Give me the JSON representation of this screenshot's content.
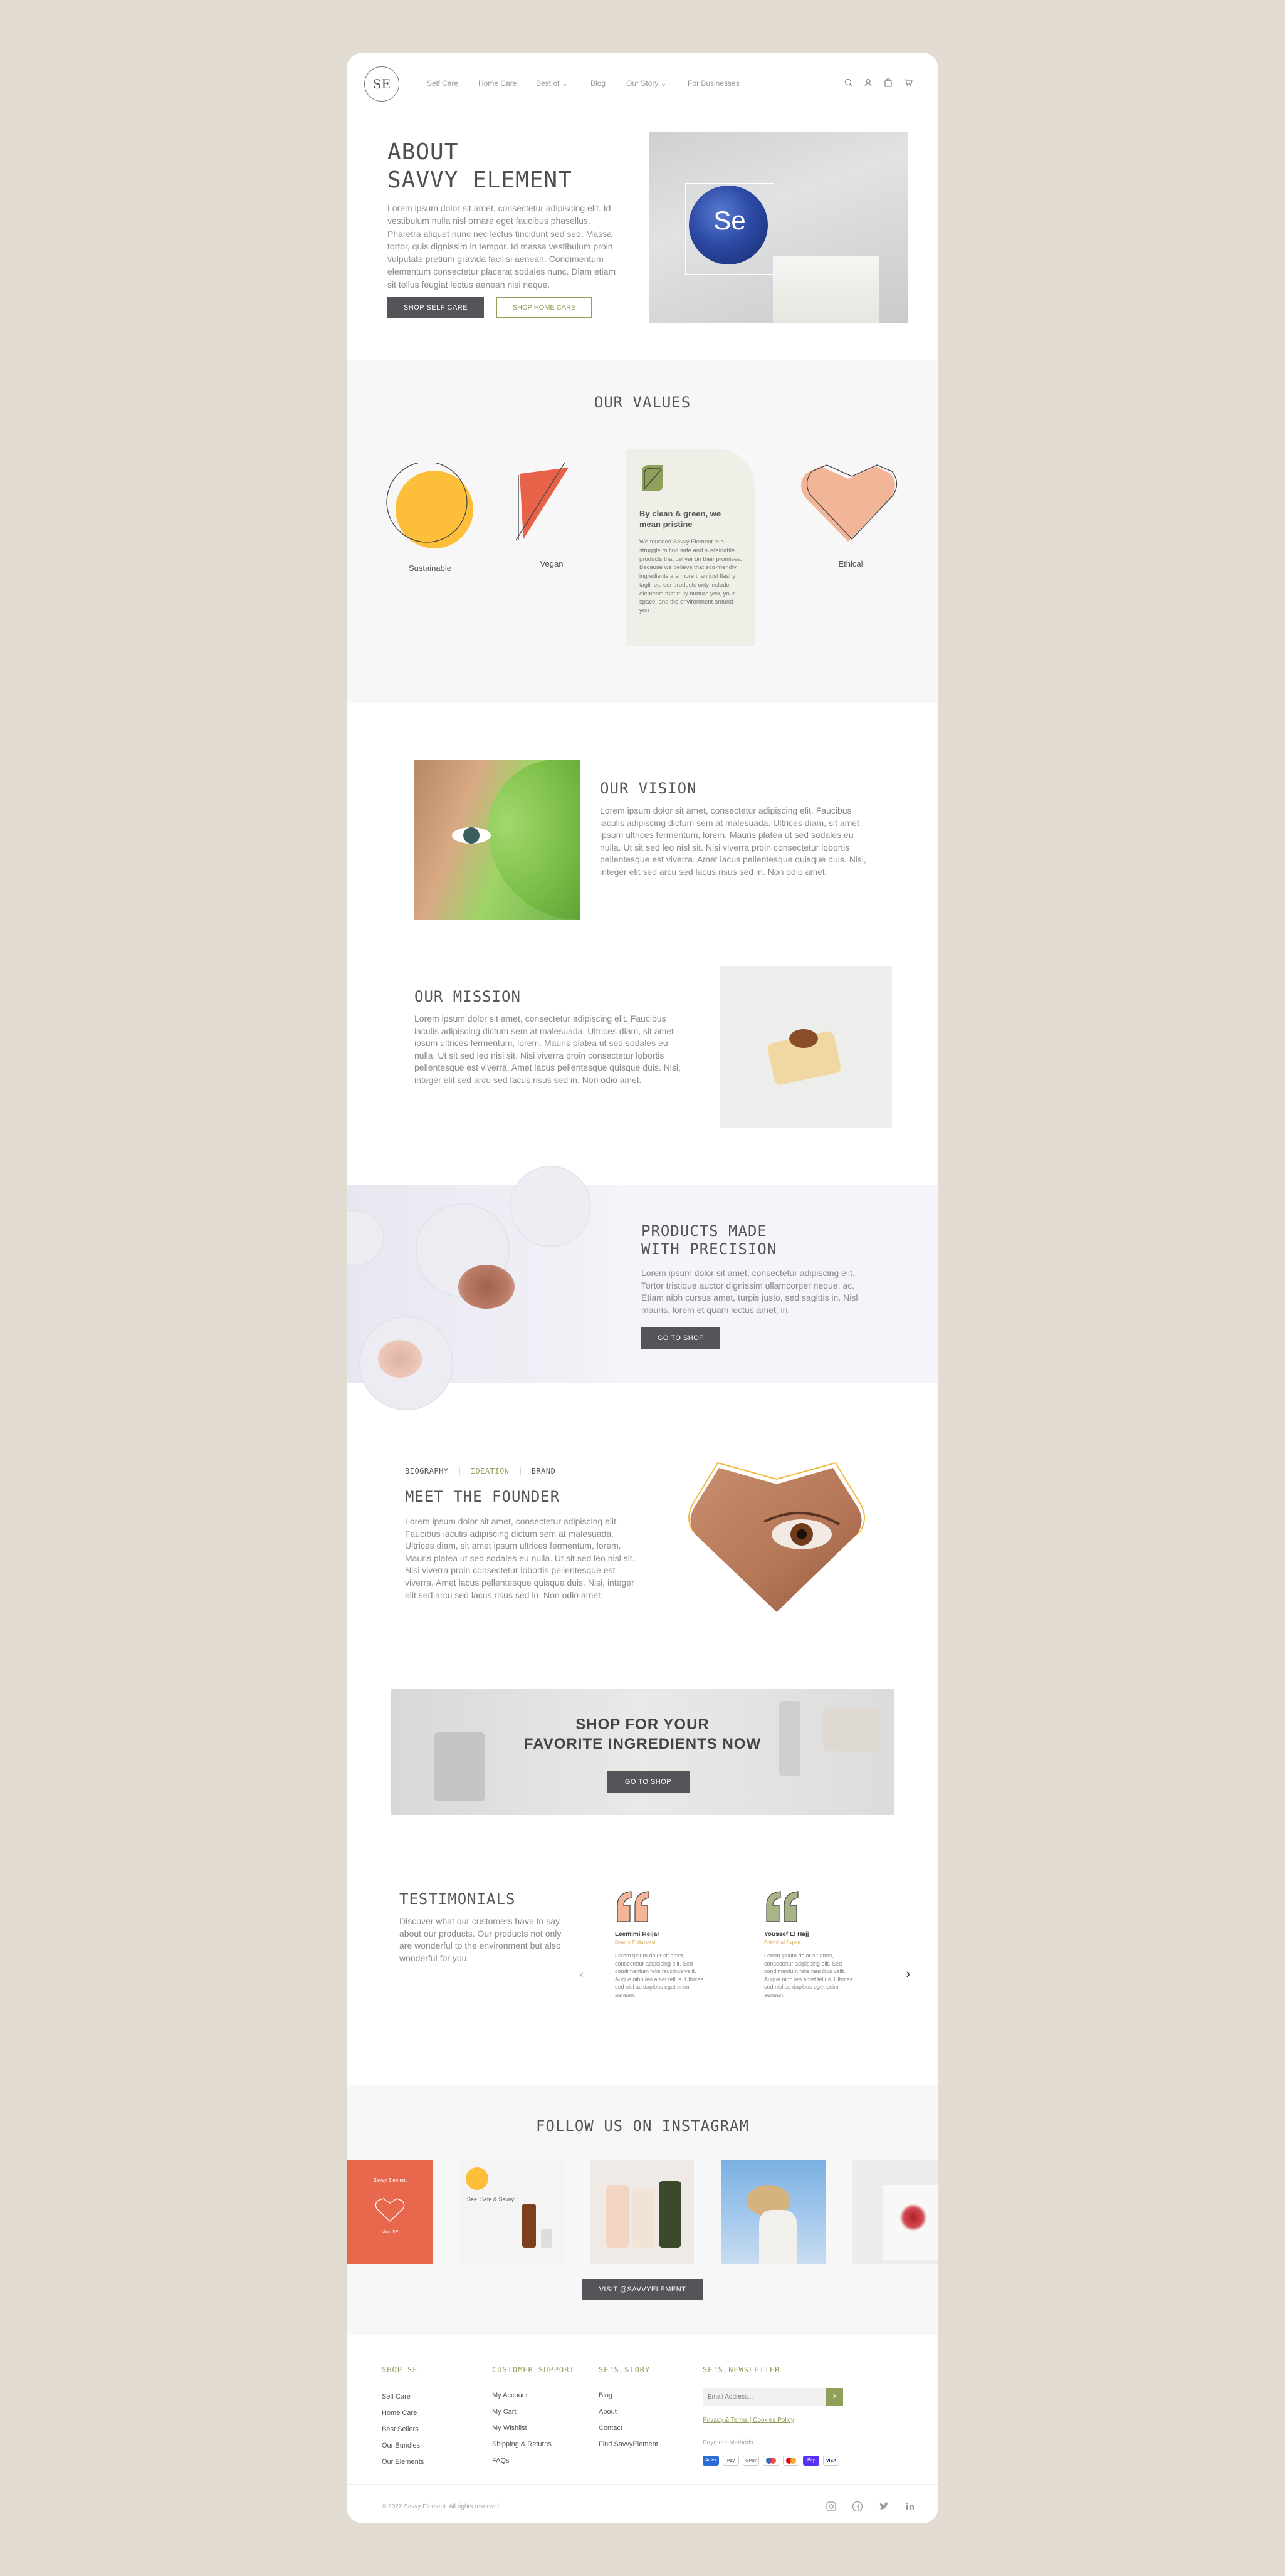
{
  "nav": {
    "logo": "SE",
    "items": [
      "Self Care",
      "Home Care",
      "Best of",
      "Blog",
      "Our Story",
      "For Businesses"
    ],
    "best_of_caret": "⌄",
    "our_story_caret": "⌄"
  },
  "hero": {
    "title_line1": "ABOUT",
    "title_line2": "SAVVY ELEMENT",
    "text": "Lorem ipsum dolor sit amet, consectetur adipiscing elit. Id vestibulum nulla nisl ornare eget faucibus phasellus. Pharetra aliquet nunc nec lectus tincidunt sed sed. Massa tortor, quis dignissim in tempor. Id massa vestibulum proin vulputate pretium gravida facilisi aenean. Condimentum elementum consectetur placerat sodales nunc. Diam etiam sit tellus feugiat lectus aenean nisi neque.",
    "btn_self_care": "SHOP SELF CARE",
    "btn_home_care": "SHOP HOME CARE",
    "photo_mark": "Se"
  },
  "values": {
    "title": "OUR VALUES",
    "items": [
      "Sustainable",
      "Vegan",
      "Ethical"
    ],
    "card_title": "By clean & green, we mean pristine",
    "card_text": "We founded Savvy Element in a struggle to find safe and sustainable products that deliver on their promises. Because we believe that eco-friendly ingredients are more than just flashy taglines, our products only include elements that truly nurture you, your space, and the environment around you."
  },
  "vision": {
    "title": "OUR VISION",
    "text": "Lorem ipsum dolor sit amet, consectetur adipiscing elit. Faucibus iaculis adipiscing dictum sem at malesuada. Ultrices diam, sit amet ipsum ultrices fermentum, lorem. Mauris platea ut sed sodales eu nulla. Ut sit sed leo nisl sit. Nisi viverra proin consectetur lobortis pellentesque est viverra. Amet lacus pellentesque quisque duis. Nisi, integer elit sed arcu sed lacus risus sed in. Non odio amet."
  },
  "mission": {
    "title": "OUR MISSION",
    "text": "Lorem ipsum dolor sit amet, consectetur adipiscing elit. Faucibus iaculis adipiscing dictum sem at malesuada. Ultrices diam, sit amet ipsum ultrices fermentum, lorem. Mauris platea ut sed sodales eu nulla. Ut sit sed leo nisl sit. Nisi viverra proin consectetur lobortis pellentesque est viverra. Amet lacus pellentesque quisque duis. Nisi, integer elit sed arcu sed lacus risus sed in. Non odio amet."
  },
  "precision": {
    "title_line1": "PRODUCTS MADE",
    "title_line2": "WITH PRECISION",
    "text": "Lorem ipsum dolor sit amet, consectetur adipiscing elit. Tortor tristique auctor dignissim ullamcorper neque, ac. Etiam nibh cursus amet, turpis justo, sed sagittis in. Nisl mauris, lorem et quam lectus amet, in.",
    "btn": "GO TO SHOP"
  },
  "founder": {
    "tabs": [
      "BIOGRAPHY",
      "IDEATION",
      "BRAND"
    ],
    "separator": "|",
    "title": "MEET THE FOUNDER",
    "text": "Lorem ipsum dolor sit amet, consectetur adipiscing elit. Faucibus iaculis adipiscing dictum sem at malesuada. Ultrices diam, sit amet ipsum ultrices fermentum, lorem. Mauris platea ut sed sodales eu nulla. Ut sit sed leo nisl sit. Nisi viverra proin consectetur lobortis pellentesque est viverra. Amet lacus pellentesque quisque duis. Nisi, integer elit sed arcu sed lacus risus sed in. Non odio amet."
  },
  "banner": {
    "title_line1": "SHOP FOR YOUR",
    "title_line2": "FAVORITE INGREDIENTS NOW",
    "btn": "GO TO SHOP"
  },
  "testimonials": {
    "title": "TESTIMONIALS",
    "intro": "Discover what our customers have to say about our products. Our products not only are wonderful to the environment but also wonderful for you.",
    "prev": "‹",
    "next": "›",
    "items": [
      {
        "name": "Leemimi Reijar",
        "role": "Beauty Enthusiast",
        "text": "Lorem ipsum dolor sit amet, consectetur adipiscing elit. Sed condimentum felis faucibus velit. Augue nibh leo amet tellus. Ultrices sed nisl ac dapibus eget enim aenean."
      },
      {
        "name": "Youssef El Hajj",
        "role": "Botanical Expert",
        "text": "Lorem ipsum dolor sit amet, consectetur adipiscing elit. Sed condimentum felis faucibus velit. Augue nibh leo amet tellus. Ultrices sed nisl ac dapibus eget enim aenean."
      }
    ]
  },
  "instagram": {
    "title": "FOLLOW US ON INSTAGRAM",
    "tile1_text": "Savvy Element",
    "tile1_sub": "shop SE",
    "tile2_text": "See, Safe & Savvy!",
    "btn": "VISIT @SAVVYELEMENT"
  },
  "footer": {
    "columns": [
      {
        "title": "SHOP SE",
        "links": [
          "Self Care",
          "Home Care",
          "Best Sellers",
          "Our Bundles",
          "Our Elements"
        ]
      },
      {
        "title": "CUSTOMER SUPPORT",
        "links": [
          "My Account",
          "My Cart",
          "My Wishlist",
          "Shipping & Returns",
          "FAQs"
        ]
      },
      {
        "title": "SE'S STORY",
        "links": [
          "Blog",
          "About",
          "Contact",
          "Find SavvyElement"
        ]
      }
    ],
    "newsletter_title": "SE'S NEWSLETTER",
    "email_placeholder": "Email Address...",
    "submit": "›",
    "policy": "Privacy & Terms | Cookies Policy",
    "payment_label": "Payment Methods",
    "payments": [
      "Amex",
      "Pay",
      "GPay",
      "",
      "",
      "Pay",
      "VISA"
    ],
    "copyright": "© 2022 Savvy Element. All rights reserved."
  },
  "colors": {
    "accent": "#8fa05a",
    "dark_button": "#555559",
    "yellow": "#fdbf3a",
    "coral": "#e8624a",
    "peach": "#f2b598"
  }
}
